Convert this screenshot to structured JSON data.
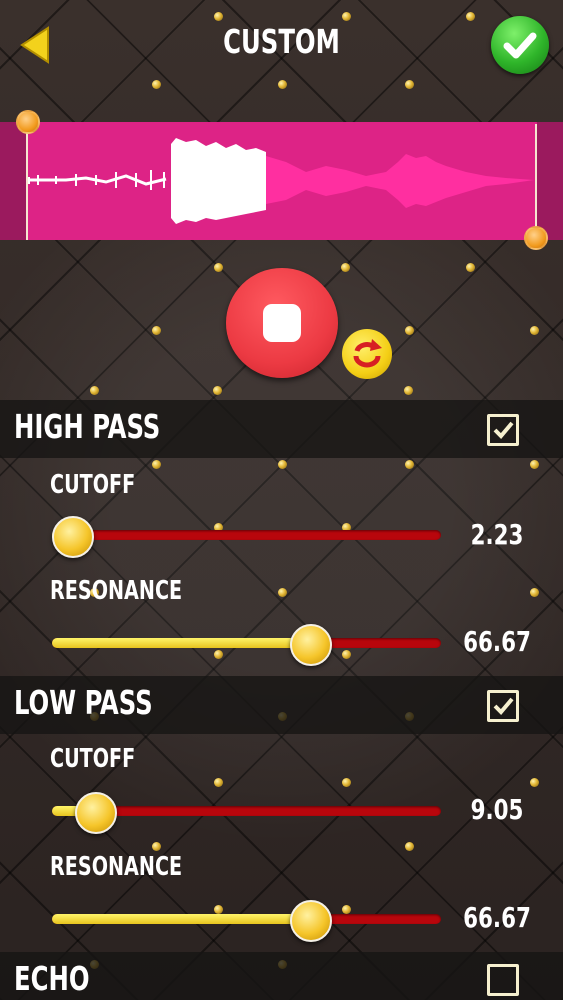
{
  "header": {
    "title": "CUSTOM"
  },
  "colors": {
    "accent_pink": "#d81f83",
    "record_red": "#ec3a43",
    "slider_track": "#b8060c",
    "slider_fill": "#e7c41e",
    "ok_green": "#2fb52a"
  },
  "icons": {
    "back": "back-arrow-icon",
    "confirm": "checkmark-icon",
    "record": "stop-icon",
    "loop": "loop-icon"
  },
  "sections": {
    "high_pass": {
      "title": "HIGH PASS",
      "checked": true,
      "cutoff": {
        "label": "CUTOFF",
        "value": "2.23",
        "fraction": 0.03
      },
      "resonance": {
        "label": "RESONANCE",
        "value": "66.67",
        "fraction": 0.667
      }
    },
    "low_pass": {
      "title": "LOW PASS",
      "checked": true,
      "cutoff": {
        "label": "CUTOFF",
        "value": "9.05",
        "fraction": 0.09
      },
      "resonance": {
        "label": "RESONANCE",
        "value": "66.67",
        "fraction": 0.667
      }
    },
    "echo": {
      "title": "ECHO",
      "checked": false
    }
  }
}
